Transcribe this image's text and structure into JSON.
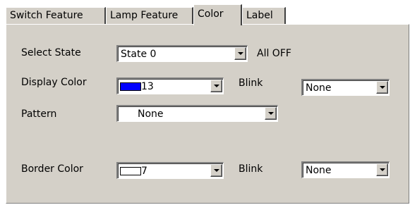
{
  "tabs": [
    {
      "label": "Switch Feature",
      "active": false
    },
    {
      "label": "Lamp Feature",
      "active": false
    },
    {
      "label": "Color",
      "active": true
    },
    {
      "label": "Label",
      "active": false
    }
  ],
  "select_state": {
    "label": "Select State",
    "value": "State 0",
    "status_text": "All OFF"
  },
  "display_color": {
    "label": "Display Color",
    "value": "13",
    "swatch_color": "#0000ff",
    "blink_label": "Blink",
    "blink_value": "None"
  },
  "pattern": {
    "label": "Pattern",
    "value": "None"
  },
  "border_color": {
    "label": "Border Color",
    "value": "7",
    "swatch_color": "#ffffff",
    "blink_label": "Blink",
    "blink_value": "None"
  },
  "colors": {
    "panel_bg": "#d4d0c8",
    "field_bg": "#ffffff"
  }
}
